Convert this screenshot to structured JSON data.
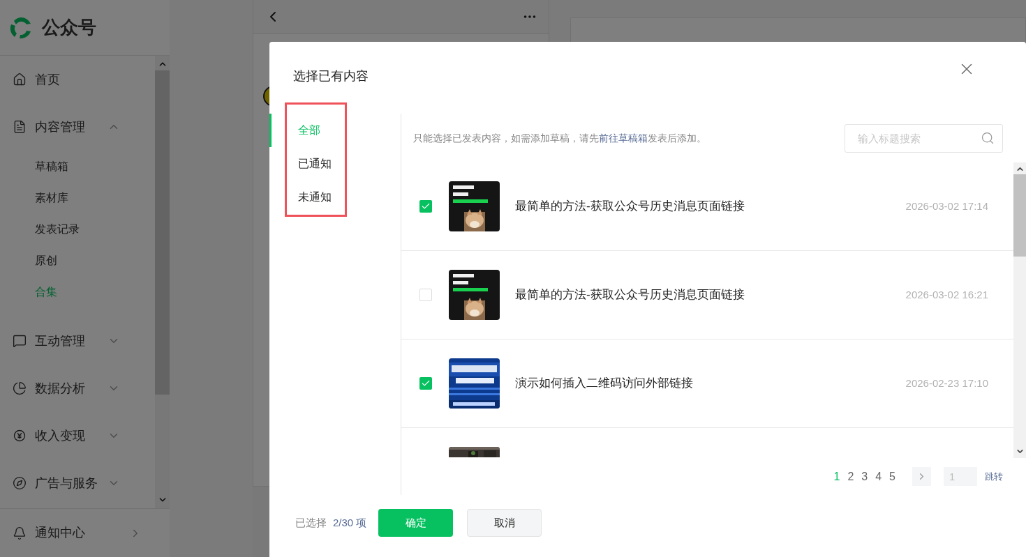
{
  "sidebar": {
    "logo": "公众号",
    "items": [
      {
        "label": "首页",
        "kind": "home",
        "expandable": false
      },
      {
        "label": "内容管理",
        "kind": "content",
        "expandable": true,
        "expanded": true,
        "children": [
          {
            "label": "草稿箱",
            "selected": false
          },
          {
            "label": "素材库",
            "selected": false
          },
          {
            "label": "发表记录",
            "selected": false
          },
          {
            "label": "原创",
            "selected": false
          },
          {
            "label": "合集",
            "selected": true
          }
        ]
      },
      {
        "label": "互动管理",
        "kind": "chat",
        "expandable": true,
        "expanded": false
      },
      {
        "label": "数据分析",
        "kind": "chart",
        "expandable": true,
        "expanded": false
      },
      {
        "label": "收入变现",
        "kind": "yen",
        "expandable": true,
        "expanded": false
      },
      {
        "label": "广告与服务",
        "kind": "compass",
        "expandable": true,
        "expanded": false
      }
    ],
    "notify": "通知中心"
  },
  "dialog": {
    "title": "选择已有内容",
    "tabs": [
      {
        "label": "全部",
        "selected": true
      },
      {
        "label": "已通知",
        "selected": false
      },
      {
        "label": "未通知",
        "selected": false
      }
    ],
    "notice": {
      "before": "只能选择已发表内容，如需添加草稿，请先",
      "link": "前往草稿箱",
      "after": "发表后添加。"
    },
    "search": {
      "placeholder": "输入标题搜索"
    },
    "articles": [
      {
        "kind": "article",
        "title": "最简单的方法-获取公众号历史消息页面链接",
        "time": "2026-03-02 17:14",
        "checked": true
      },
      {
        "kind": "article",
        "title": "最简单的方法-获取公众号历史消息页面链接",
        "time": "2026-03-02 16:21",
        "checked": false
      },
      {
        "kind": "article",
        "title": "演示如何插入二维码访问外部链接",
        "time": "2026-02-23 17:10",
        "checked": true
      },
      {
        "kind": "cut-off"
      }
    ],
    "pages": [
      {
        "label": "1",
        "selected": true
      },
      {
        "label": "2",
        "selected": false
      },
      {
        "label": "3",
        "selected": false
      },
      {
        "label": "4",
        "selected": false
      },
      {
        "label": "5",
        "selected": false
      }
    ],
    "jump_value": "1",
    "jump": "跳转",
    "selected_label": "已选择",
    "selected_count": "2/30 项",
    "confirm": "确定",
    "cancel": "取消"
  }
}
